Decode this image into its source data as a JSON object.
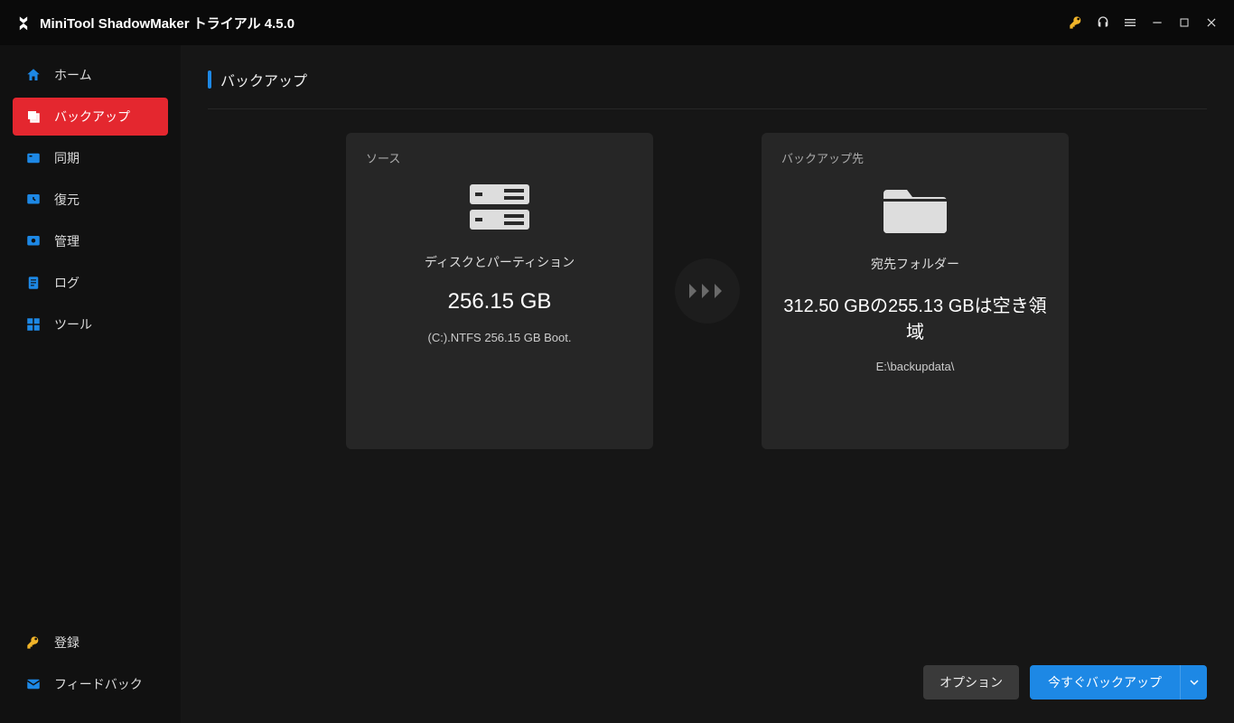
{
  "app": {
    "title": "MiniTool ShadowMaker トライアル 4.5.0"
  },
  "sidebar": {
    "items": [
      {
        "label": "ホーム"
      },
      {
        "label": "バックアップ"
      },
      {
        "label": "同期"
      },
      {
        "label": "復元"
      },
      {
        "label": "管理"
      },
      {
        "label": "ログ"
      },
      {
        "label": "ツール"
      }
    ],
    "register": "登録",
    "feedback": "フィードバック"
  },
  "page": {
    "title": "バックアップ"
  },
  "source": {
    "label": "ソース",
    "title": "ディスクとパーティション",
    "size": "256.15 GB",
    "detail": "(C:).NTFS 256.15 GB Boot."
  },
  "destination": {
    "label": "バックアップ先",
    "title": "宛先フォルダー",
    "free": "312.50 GBの255.13 GBは空き領域",
    "path": "E:\\backupdata\\"
  },
  "actions": {
    "options": "オプション",
    "backup_now": "今すぐバックアップ"
  }
}
